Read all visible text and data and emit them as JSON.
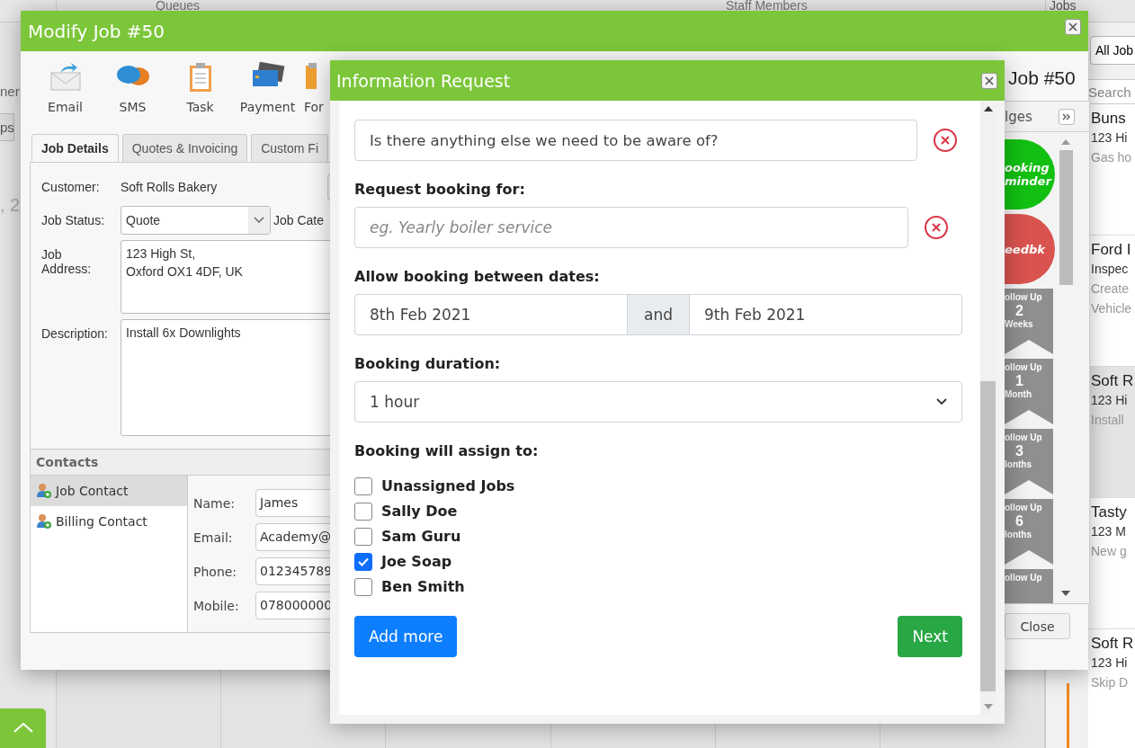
{
  "background": {
    "headers": [
      "Queues",
      "Staff Members",
      "Jobs"
    ],
    "left_fragments": [
      "ner",
      "ps",
      ", 2"
    ],
    "jobs_filter": "All Job",
    "jobs_search": {
      "placeholder": "Search"
    },
    "jobs": [
      {
        "title": "Buns",
        "lines": [
          "123 Hi",
          "Gas ho"
        ],
        "selected": false
      },
      {
        "title": "Ford I",
        "lines": [
          "Inspec",
          "Create",
          "Vehicle"
        ],
        "selected": false
      },
      {
        "title": "Soft R",
        "lines": [
          "123 Hi",
          "Install"
        ],
        "selected": true
      },
      {
        "title": "Tasty",
        "lines": [
          "123 M",
          "New g"
        ],
        "selected": false
      },
      {
        "title": "Soft R",
        "lines": [
          "123 Hi",
          "Skip D"
        ],
        "selected": false
      }
    ]
  },
  "modify_job": {
    "title": "Modify Job #50",
    "toolbar": [
      {
        "label": "Email",
        "kind": "email"
      },
      {
        "label": "SMS",
        "kind": "sms"
      },
      {
        "label": "Task",
        "kind": "task"
      },
      {
        "label": "Payment",
        "kind": "payment"
      },
      {
        "label": "For",
        "kind": "form"
      }
    ],
    "tabs": [
      {
        "label": "Job Details",
        "selected": true
      },
      {
        "label": "Quotes & Invoicing",
        "selected": false
      },
      {
        "label": "Custom Fi",
        "selected": false
      }
    ],
    "customer_label": "Customer:",
    "customer": "Soft Rolls Bakery",
    "status_label": "Job Status:",
    "status": "Quote",
    "category_label": "Job Cate",
    "address_label": "Job Address:",
    "address": "123 High St,\nOxford OX1 4DF, UK",
    "description_label": "Description:",
    "description": "Install 6x Downlights",
    "contacts_title": "Contacts",
    "contacts": [
      {
        "label": "Job Contact",
        "selected": true
      },
      {
        "label": "Billing Contact",
        "selected": false
      }
    ],
    "contact_fields": [
      {
        "label": "Name:",
        "value": "James"
      },
      {
        "label": "Email:",
        "value": "Academy@"
      },
      {
        "label": "Phone:",
        "value": "012345789"
      },
      {
        "label": "Mobile:",
        "value": "078000000"
      }
    ],
    "heading": "Job #50",
    "badges_title": "lges",
    "badges": [
      {
        "kind": "circle",
        "color": "#12c012",
        "lines": [
          "ooking",
          "minder"
        ]
      },
      {
        "kind": "circle",
        "color": "#d9534f",
        "lines": [
          "eedbk"
        ]
      },
      {
        "kind": "ribbon",
        "lines": [
          "ollow Up",
          "2",
          "Weeks"
        ]
      },
      {
        "kind": "ribbon",
        "lines": [
          "ollow Up",
          "1",
          "Month"
        ]
      },
      {
        "kind": "ribbon",
        "lines": [
          "ollow Up",
          "3",
          "lonths"
        ]
      },
      {
        "kind": "ribbon",
        "lines": [
          "ollow Up",
          "6",
          "lonths"
        ]
      },
      {
        "kind": "ribbon",
        "lines": [
          "ollow Up"
        ]
      }
    ],
    "close": "Close"
  },
  "dialog": {
    "title": "Information Request",
    "question": "Is there anything else we need to be aware of?",
    "booking_label": "Request booking for:",
    "booking": {
      "placeholder": "eg. Yearly boiler service"
    },
    "dates_label": "Allow booking between dates:",
    "date_from": "8th Feb 2021",
    "date_join": "and",
    "date_to": "9th Feb 2021",
    "duration_label": "Booking duration:",
    "duration": "1 hour",
    "assign_label": "Booking will assign to:",
    "assignees": [
      {
        "label": "Unassigned Jobs",
        "checked": false
      },
      {
        "label": "Sally Doe",
        "checked": false
      },
      {
        "label": "Sam Guru",
        "checked": false
      },
      {
        "label": "Joe Soap",
        "checked": true
      },
      {
        "label": "Ben Smith",
        "checked": false
      }
    ],
    "add_more": "Add more",
    "next": "Next"
  }
}
